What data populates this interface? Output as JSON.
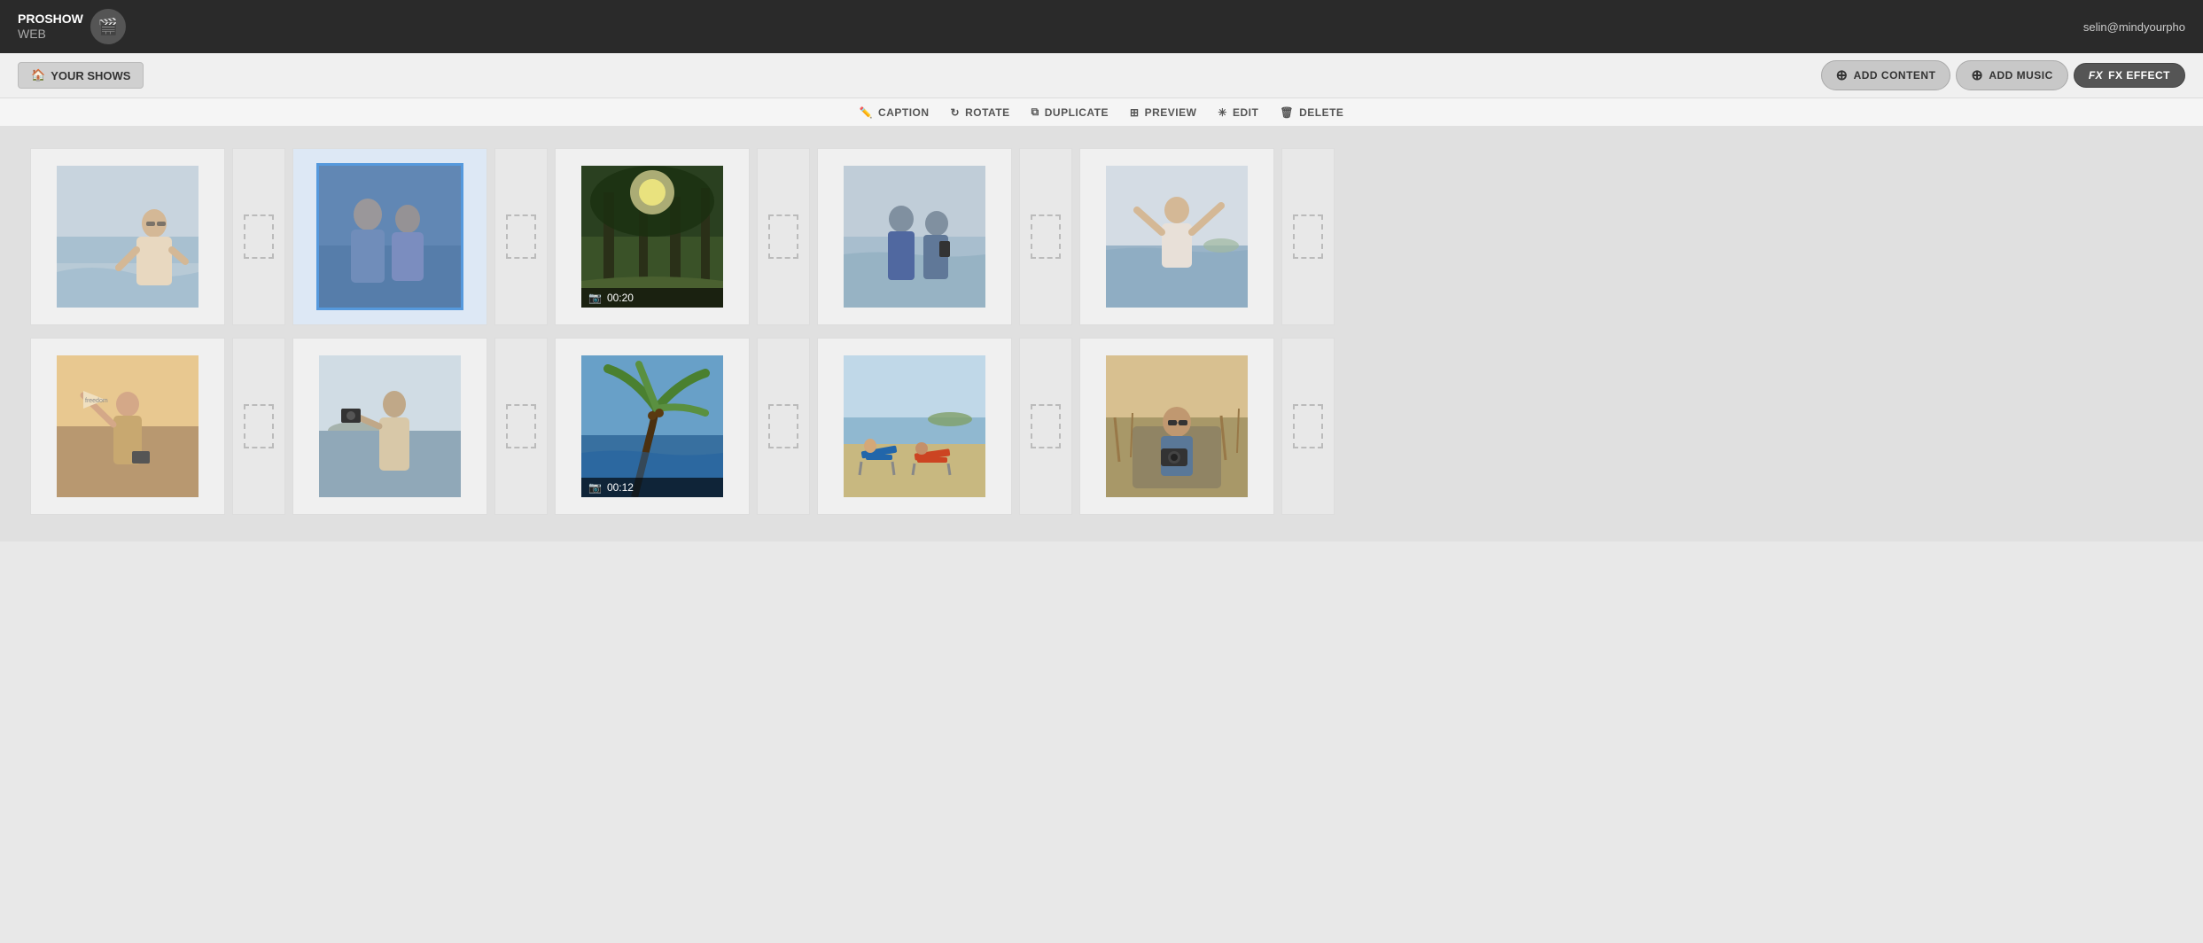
{
  "header": {
    "logo_line1": "PROSHOW",
    "logo_line2": "WEB",
    "user_email": "selin@mindyourpho"
  },
  "toolbar": {
    "your_shows_label": "YOUR SHOWS",
    "add_content_label": "ADD CONTENT",
    "add_music_label": "ADD MUSIC",
    "fx_effect_label": "FX EFFECT"
  },
  "actions": [
    {
      "id": "caption",
      "label": "CAPTION",
      "icon": "✏️"
    },
    {
      "id": "rotate",
      "label": "ROTATE",
      "icon": "↻"
    },
    {
      "id": "duplicate",
      "label": "DUPLICATE",
      "icon": "⧉"
    },
    {
      "id": "preview",
      "label": "PREVIEW",
      "icon": "⊞"
    },
    {
      "id": "edit",
      "label": "EDIT",
      "icon": "✳"
    },
    {
      "id": "delete",
      "label": "DELETE",
      "icon": "🗑"
    }
  ],
  "slides": {
    "row1": [
      {
        "id": "s1",
        "type": "photo",
        "photo_class": "photo-1",
        "selected": false
      },
      {
        "id": "s2",
        "type": "photo",
        "photo_class": "photo-2",
        "selected": true
      },
      {
        "id": "s3",
        "type": "video",
        "photo_class": "photo-3",
        "duration": "00:20"
      },
      {
        "id": "s4",
        "type": "photo",
        "photo_class": "photo-4",
        "selected": false
      },
      {
        "id": "s5",
        "type": "photo",
        "photo_class": "photo-5",
        "selected": false
      }
    ],
    "row2": [
      {
        "id": "s6",
        "type": "photo",
        "photo_class": "photo-6",
        "selected": false
      },
      {
        "id": "s7",
        "type": "photo",
        "photo_class": "photo-7",
        "selected": false
      },
      {
        "id": "s8",
        "type": "video",
        "photo_class": "photo-8",
        "duration": "00:12"
      },
      {
        "id": "s9",
        "type": "photo",
        "photo_class": "photo-9",
        "selected": false
      },
      {
        "id": "s10",
        "type": "photo",
        "photo_class": "photo-10",
        "selected": false
      }
    ]
  },
  "video_icon": "🎬",
  "colors": {
    "selected_border": "#5599dd",
    "selected_overlay": "rgba(70,130,200,0.35)",
    "dash_border": "#bbb"
  }
}
